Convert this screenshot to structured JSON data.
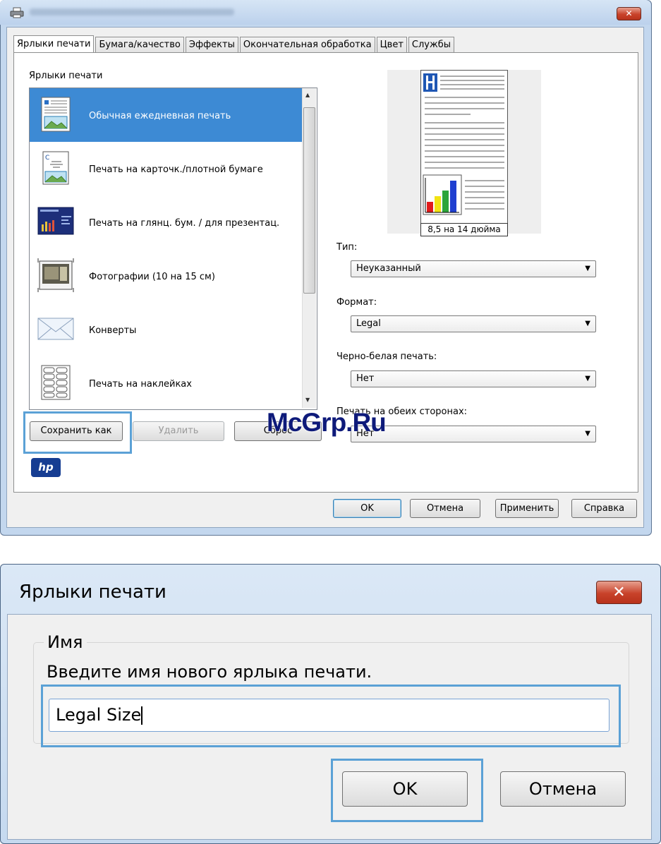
{
  "dialog1": {
    "tabs": [
      "Ярлыки печати",
      "Бумага/качество",
      "Эффекты",
      "Окончательная обработка",
      "Цвет",
      "Службы"
    ],
    "shortcuts_heading": "Ярлыки печати",
    "shortcuts": [
      {
        "label": "Обычная ежедневная печать",
        "icon": "everyday-document-icon",
        "selected": true
      },
      {
        "label": "Печать на карточк./плотной бумаге",
        "icon": "cardstock-icon"
      },
      {
        "label": "Печать на глянц. бум. / для презентац.",
        "icon": "presentation-icon"
      },
      {
        "label": "Фотографии (10 на 15 см)",
        "icon": "photo-icon"
      },
      {
        "label": "Конверты",
        "icon": "envelope-icon"
      },
      {
        "label": "Печать на наклейках",
        "icon": "labels-icon"
      }
    ],
    "buttons": {
      "save_as": "Сохранить как",
      "delete": "Удалить",
      "reset": "Сброс"
    },
    "preview_caption": "8,5 на 14 дюйма",
    "fields": {
      "type_label": "Тип:",
      "type_value": "Неуказанный",
      "format_label": "Формат:",
      "format_value": "Legal",
      "bw_label": "Черно-белая печать:",
      "bw_value": "Нет",
      "duplex_label": "Печать на обеих сторонах:",
      "duplex_value": "Нет"
    },
    "logo_text": "hp",
    "watermark": "McGrp.Ru",
    "footer": {
      "ok": "OK",
      "cancel": "Отмена",
      "apply": "Применить",
      "help": "Справка"
    },
    "close_glyph": "✕"
  },
  "dialog2": {
    "title": "Ярлыки печати",
    "group_label": "Имя",
    "prompt": "Введите имя нового ярлыка печати.",
    "name_value": "Legal Size",
    "ok": "OK",
    "cancel": "Отмена",
    "close_glyph": "✕"
  },
  "colors": {
    "selection": "#3d8ad4",
    "highlight": "#5ba1d6",
    "hp_blue": "#163d92"
  }
}
